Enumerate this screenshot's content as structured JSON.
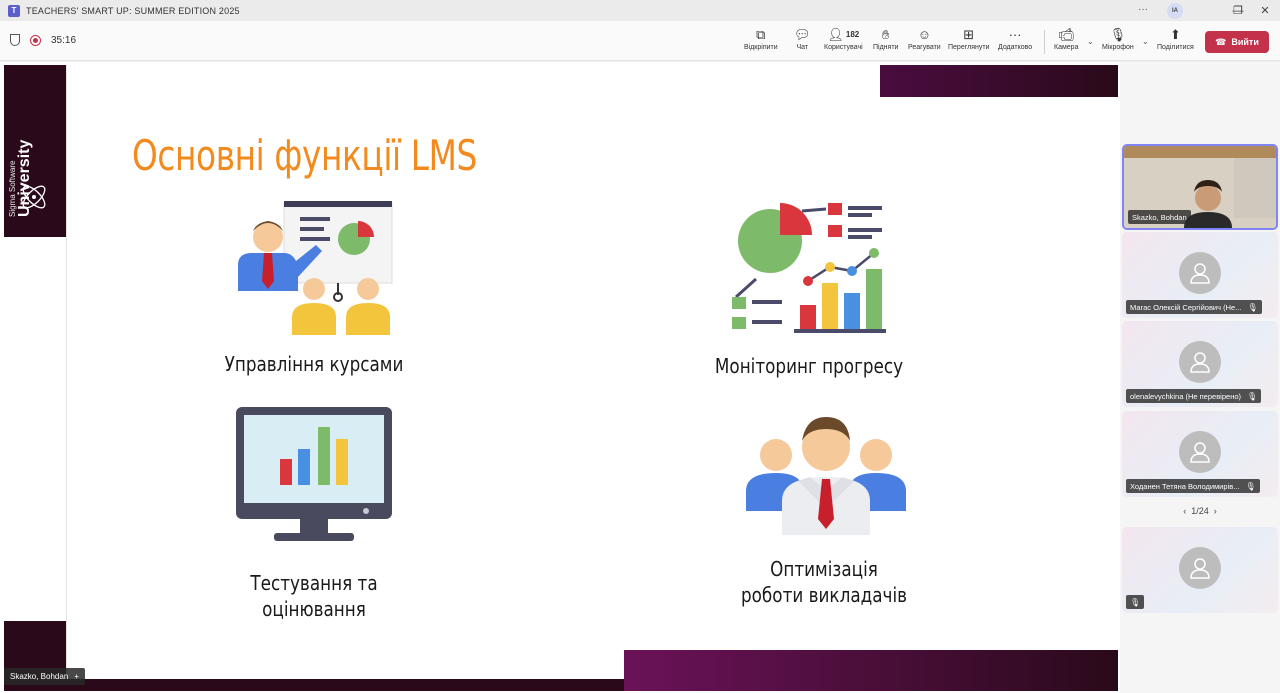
{
  "window": {
    "title": "TEACHERS' SMART UP: SUMMER EDITION 2025",
    "user_initials": "IA",
    "controls": {
      "more": "···",
      "minimize": "—",
      "maximize": "❐",
      "close": "✕"
    }
  },
  "toolbar": {
    "timer": "35:16",
    "buttons": {
      "pop_out": "Відкріпити",
      "chat": "Чат",
      "people": "Користувачі",
      "people_count": "182",
      "raise_hand": "Підняти",
      "react": "Реагувати",
      "view": "Переглянути",
      "more": "Додатково",
      "camera": "Камера",
      "mic": "Мікрофон",
      "share": "Поділитися",
      "leave": "Вийти"
    }
  },
  "slide": {
    "brand_small": "Sigma Software",
    "brand_big": "University",
    "title": "Основні функції LMS",
    "functions": [
      {
        "label": "Управління курсами"
      },
      {
        "label": "Моніторинг прогресу"
      },
      {
        "label": "Тестування та оцінювання"
      },
      {
        "label": "Оптимізація роботи викладачів"
      }
    ]
  },
  "presenter_tag": "Skazko, Bohdan",
  "participants": [
    {
      "name": "Skazko, Bohdan",
      "video": true
    },
    {
      "name": "Магас Олексій Сергійович (Не...",
      "video": false
    },
    {
      "name": "olenalevychkina (Не перевірено)",
      "video": false
    },
    {
      "name": "Ходанен Тетяна Володимирів...",
      "video": false
    },
    {
      "name": "",
      "video": false
    }
  ],
  "pager": {
    "text": "1/24"
  },
  "colors": {
    "accent": "#f28a1e",
    "leave": "#c4314b",
    "brand_dark": "#2a0a1a",
    "active_border": "#7f85f5"
  }
}
